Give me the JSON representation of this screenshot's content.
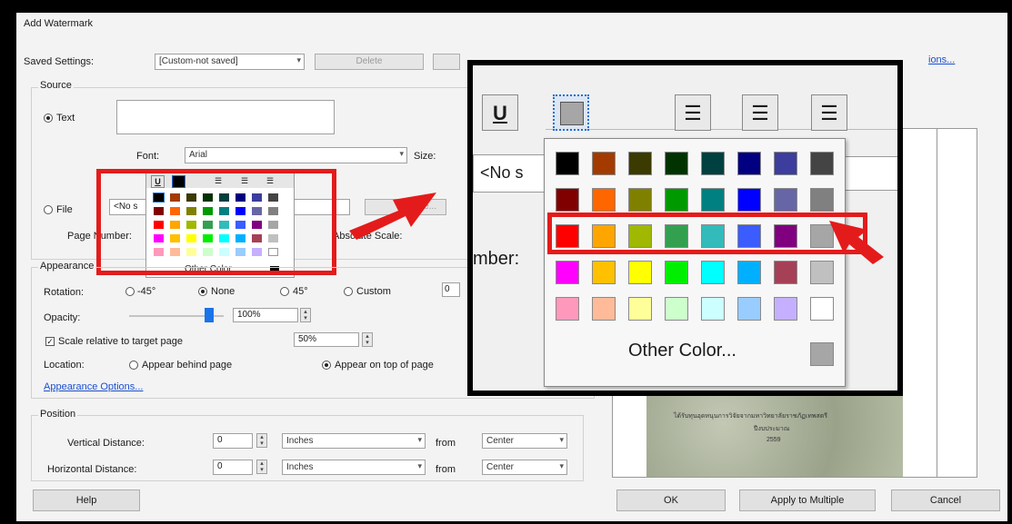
{
  "dialog": {
    "title": "Add Watermark"
  },
  "saved_settings": {
    "label": "Saved Settings:",
    "value": "[Custom-not saved]",
    "delete_label": "Delete",
    "options_link": "ions..."
  },
  "source": {
    "group_label": "Source",
    "text_label": "Text",
    "font_label": "Font:",
    "font_value": "Arial",
    "size_label": "Size:",
    "file_label": "File",
    "file_value": "<No s",
    "browse_label": "se...",
    "page_number_label": "Page Number:",
    "absolute_scale_label": "Absolute Scale:",
    "other_color_label": "Other Color"
  },
  "appearance": {
    "group_label": "Appearance",
    "rotation_label": "Rotation:",
    "rot_m45": "-45°",
    "rot_none": "None",
    "rot_45": "45°",
    "rot_custom": "Custom",
    "custom_value": "0",
    "opacity_label": "Opacity:",
    "opacity_value": "100%",
    "scale_label": "Scale relative to target page",
    "scale_value": "50%",
    "location_label": "Location:",
    "behind_label": "Appear behind page",
    "ontop_label": "Appear on top of page",
    "options_link": "Appearance Options..."
  },
  "position": {
    "group_label": "Position",
    "vertical_label": "Vertical Distance:",
    "vertical_value": "0",
    "horizontal_label": "Horizontal Distance:",
    "horizontal_value": "0",
    "units": "Inches",
    "from_label": "from",
    "anchor": "Center"
  },
  "footer": {
    "help": "Help",
    "ok": "OK",
    "apply_multiple": "Apply to Multiple",
    "cancel": "Cancel"
  },
  "zoom": {
    "underline_icon_text": "U",
    "file_fragment": "<No s",
    "page_number_fragment": "mber:",
    "other_color_label": "Other Color..."
  },
  "preview": {
    "doc_line1": "ได้รับทุนอุดหนุนการวิจัยจากมหาวิทยาลัยราชภัฏเทพสตรี",
    "doc_line2": "ปีงบประมาณ",
    "doc_line3": "2559"
  },
  "palette": [
    [
      "#000000",
      "#a33b00",
      "#3b3a00",
      "#003300",
      "#004040",
      "#000080",
      "#3c3d9c",
      "#444444"
    ],
    [
      "#800000",
      "#ff6600",
      "#808000",
      "#009900",
      "#008080",
      "#0000ff",
      "#6666a6",
      "#808080"
    ],
    [
      "#ff0000",
      "#ffa500",
      "#a0b800",
      "#33a050",
      "#33bbbb",
      "#3b5cff",
      "#800080",
      "#a6a6a6"
    ],
    [
      "#ff00ff",
      "#ffc000",
      "#ffff00",
      "#00ee00",
      "#00ffff",
      "#00b0ff",
      "#a64057",
      "#c0c0c0"
    ],
    [
      "#ff99bb",
      "#ffbb99",
      "#ffff99",
      "#ccffcc",
      "#ccffff",
      "#99ccff",
      "#c4b0ff",
      "#ffffff"
    ]
  ],
  "colors": {
    "accent_red": "#e41b1b",
    "selected_color": "#a6a6a6"
  }
}
